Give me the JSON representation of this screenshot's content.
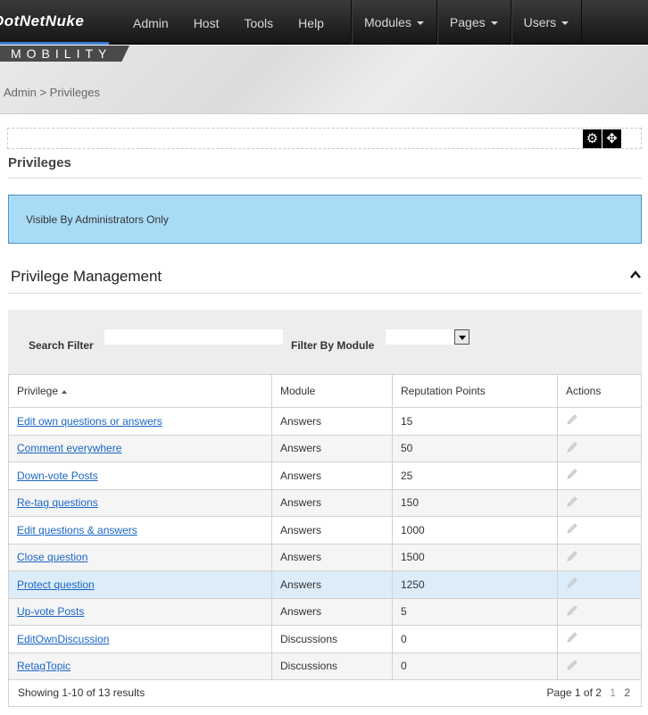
{
  "topbar": {
    "logo_text": "DotNetNuke",
    "left_nav": [
      "Admin",
      "Host",
      "Tools",
      "Help"
    ],
    "right_nav": [
      "Modules",
      "Pages",
      "Users"
    ]
  },
  "banner": {
    "skin_label": "MOBILITY",
    "breadcrumb": "Admin > Privileges"
  },
  "module": {
    "title": "Privileges",
    "notice": "Visible By Administrators Only",
    "section_title": "Privilege Management"
  },
  "filters": {
    "search_label": "Search Filter",
    "search_value": "",
    "module_label": "Filter By Module",
    "module_value": ""
  },
  "table": {
    "headers": [
      "Privilege",
      "Module",
      "Reputation Points",
      "Actions"
    ],
    "rows": [
      {
        "privilege": "Edit own questions or answers",
        "module": "Answers",
        "points": "15"
      },
      {
        "privilege": "Comment everywhere",
        "module": "Answers",
        "points": "50"
      },
      {
        "privilege": "Down-vote Posts",
        "module": "Answers",
        "points": "25"
      },
      {
        "privilege": "Re-tag questions",
        "module": "Answers",
        "points": "150"
      },
      {
        "privilege": "Edit questions & answers",
        "module": "Answers",
        "points": "1000"
      },
      {
        "privilege": "Close question",
        "module": "Answers",
        "points": "1500"
      },
      {
        "privilege": "Protect question",
        "module": "Answers",
        "points": "1250"
      },
      {
        "privilege": "Up-vote Posts",
        "module": "Answers",
        "points": "5"
      },
      {
        "privilege": "EditOwnDiscussion",
        "module": "Discussions",
        "points": "0"
      },
      {
        "privilege": "RetagTopic",
        "module": "Discussions",
        "points": "0"
      }
    ]
  },
  "pager": {
    "summary": "Showing 1-10 of 13 results",
    "page_info": "Page 1 of 2",
    "page_1": "1",
    "page_2": "2"
  },
  "colors": {
    "accent": "#3d7fd0",
    "link": "#1a66c5",
    "notice_bg": "#a9dbf7",
    "selected_row": "#dcecf9"
  }
}
